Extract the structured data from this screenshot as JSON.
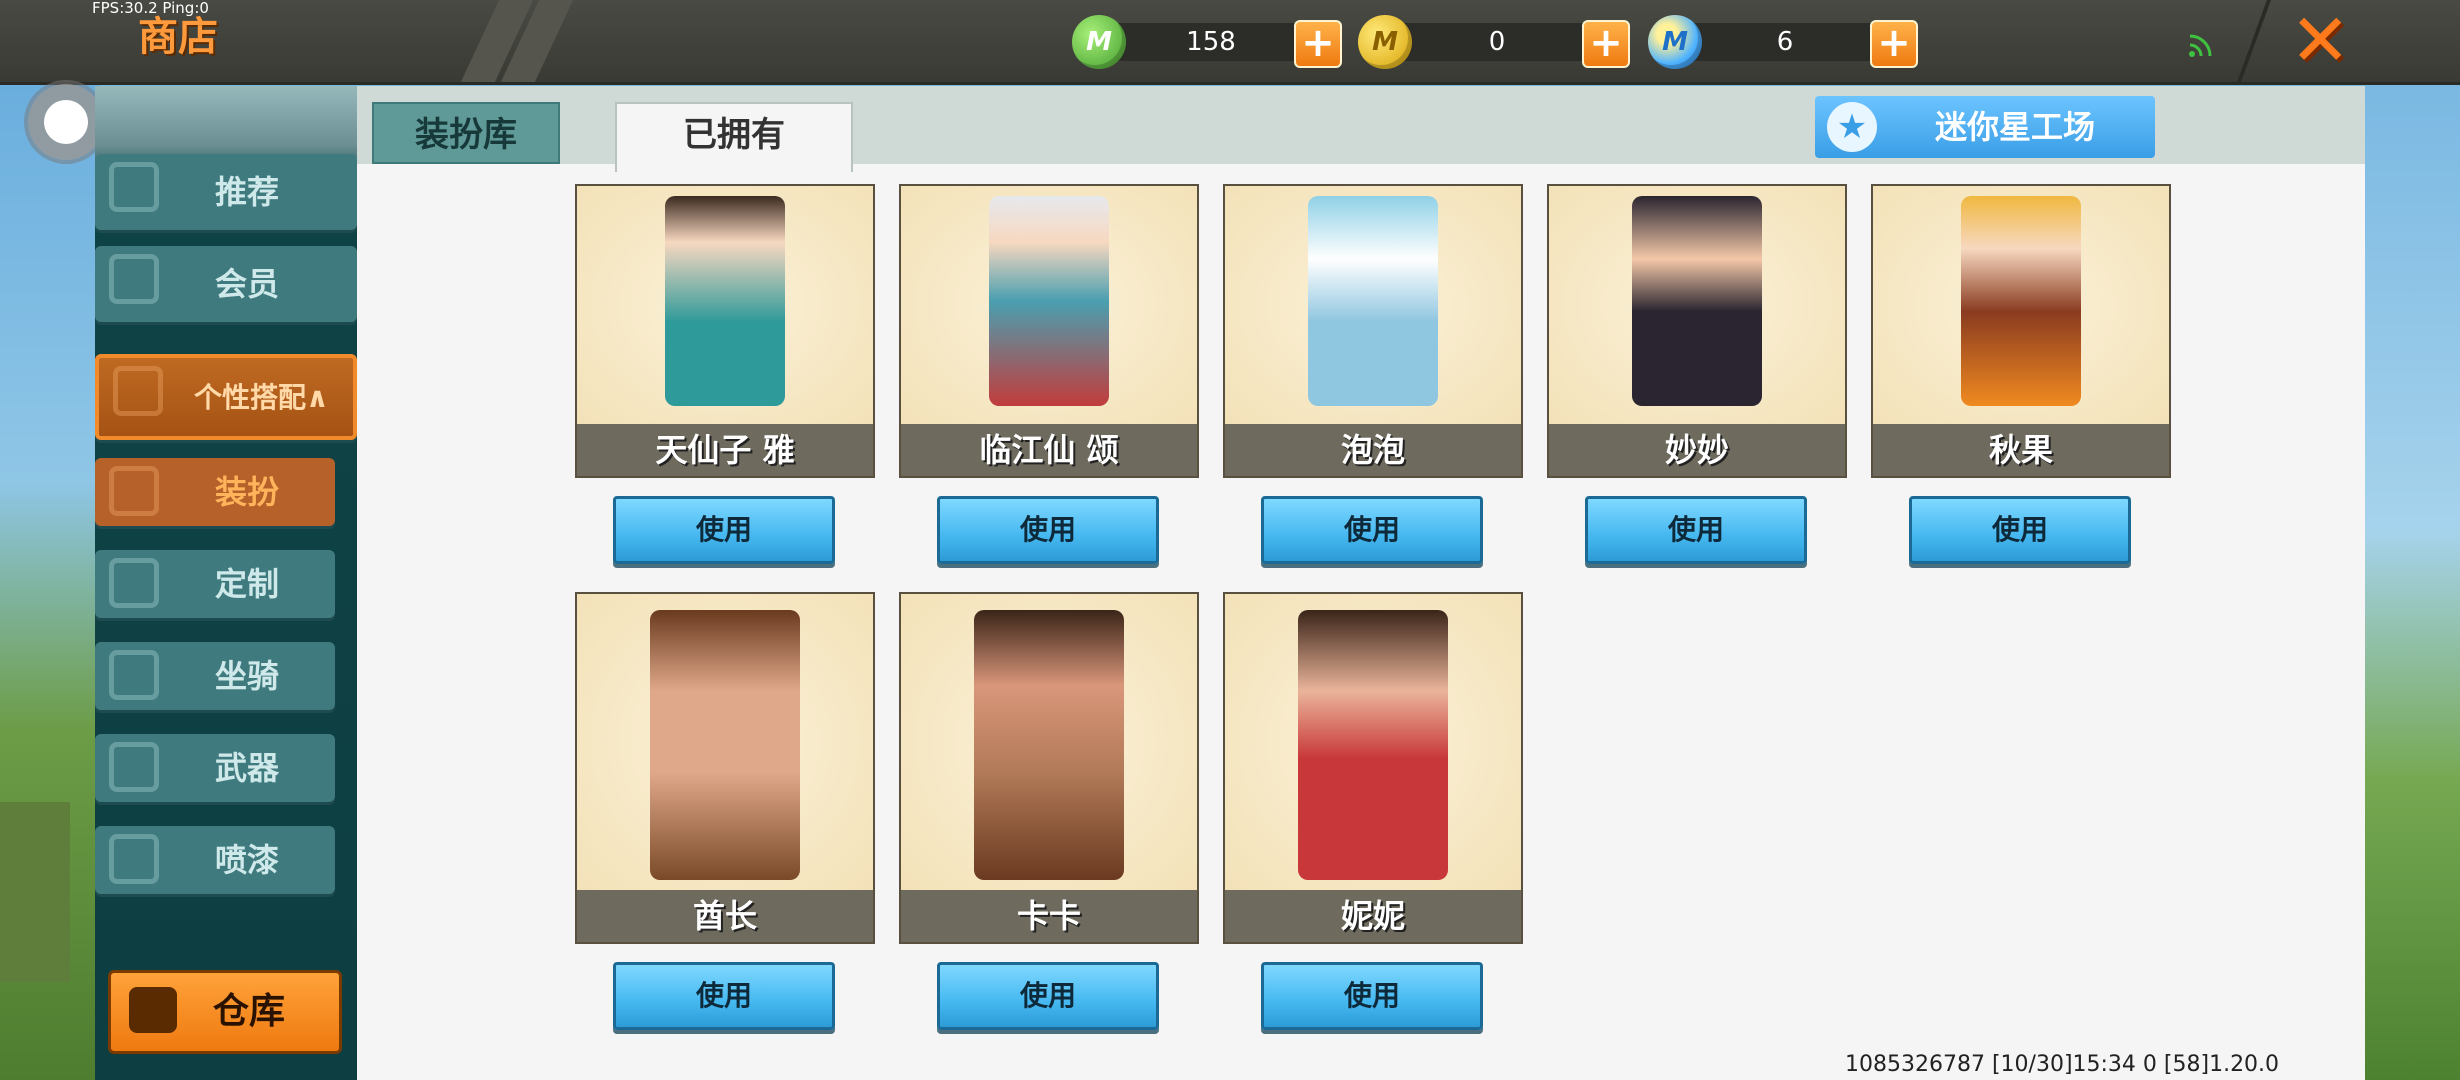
{
  "debug": {
    "fps_text": "FPS:30.2  Ping:0"
  },
  "header": {
    "title": "商店",
    "currencies": [
      {
        "icon": "green-gem-icon",
        "value": "158"
      },
      {
        "icon": "gold-coin-icon",
        "value": "0"
      },
      {
        "icon": "mini-coin-icon",
        "value": "6"
      }
    ],
    "plus_label": "+",
    "close_label": "✕"
  },
  "sidebar": {
    "items": [
      {
        "label": "推荐"
      },
      {
        "label": "会员"
      },
      {
        "label": "个性搭配∧"
      },
      {
        "label": "装扮"
      },
      {
        "label": "定制"
      },
      {
        "label": "坐骑"
      },
      {
        "label": "武器"
      },
      {
        "label": "喷漆"
      }
    ],
    "warehouse_label": "仓库"
  },
  "tabs": [
    {
      "label": "装扮库",
      "selected": false
    },
    {
      "label": "已拥有",
      "selected": true
    }
  ],
  "workshop_label": "迷你星工场",
  "use_label": "使用",
  "skins": [
    {
      "name": "天仙子 雅"
    },
    {
      "name": "临江仙 颂"
    },
    {
      "name": "泡泡"
    },
    {
      "name": "妙妙"
    },
    {
      "name": "秋果"
    },
    {
      "name": "酋长"
    },
    {
      "name": "卡卡"
    },
    {
      "name": "妮妮"
    }
  ],
  "status_line": "1085326787  [10/30]15:34 0  [58]1.20.0"
}
